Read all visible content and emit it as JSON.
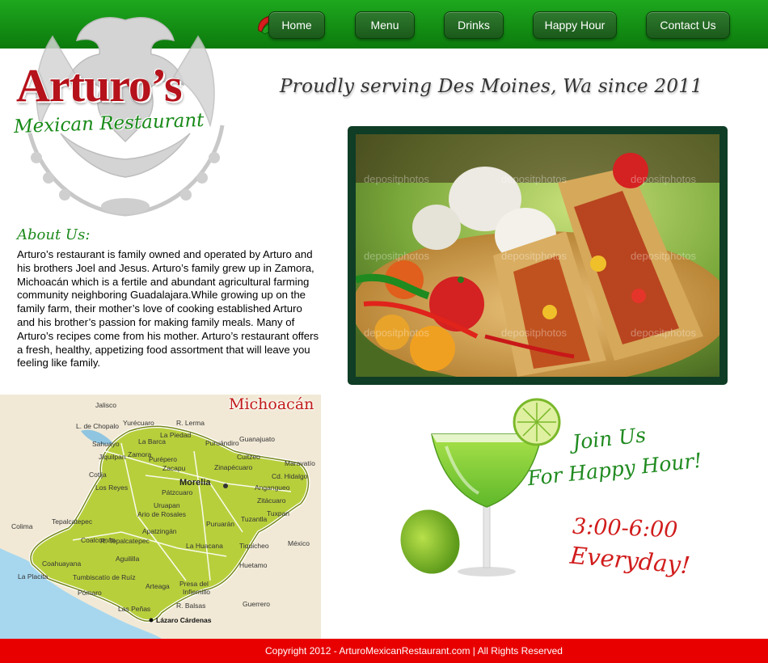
{
  "nav": {
    "items": [
      {
        "label": "Home"
      },
      {
        "label": "Menu"
      },
      {
        "label": "Drinks"
      },
      {
        "label": "Happy Hour"
      },
      {
        "label": "Contact Us"
      }
    ]
  },
  "logo": {
    "title": "Arturo’s",
    "subtitle": "Mexican Restaurant"
  },
  "tagline": "Proudly serving Des Moines, Wa since 2011",
  "about": {
    "heading": "About Us:",
    "text": "Arturo’s restaurant is family owned and operated by Arturo and his brothers Joel and Jesus. Arturo’s family grew up in Zamora, Michoacán which is a fertile and abundant agricultural farming community neighboring Guadalajara.While growing up on the family farm, their mother’s love of cooking established Arturo and his brother’s passion for making family meals. Many of Arturo’s recipes come from his mother. Arturo’s restaurant offers a fresh, healthy, appetizing food assortment that will leave you feeling like family."
  },
  "map": {
    "title": "Michoacán",
    "labels": [
      "Jalisco",
      "L. de Chopalo",
      "Yurécuaro",
      "R. Lerma",
      "Guanajuato",
      "La Piedad",
      "Sahuayo",
      "La Barca",
      "Jiquilpan",
      "Zamora",
      "Cotija",
      "Los Reyes",
      "Purépero",
      "Puruándiro",
      "Zacapu",
      "Pátzcuaro",
      "Morelia",
      "Zinapécuaro",
      "Cuitzeo",
      "Maravatío",
      "Cd. Hidalgo",
      "Angangueo",
      "Zitácuaro",
      "Tuxpan",
      "Uruapan",
      "Ario de Rosales",
      "Apatzingán",
      "Tepalcatepec",
      "Coalcomán",
      "Aguililla",
      "La Huacana",
      "Puruarán",
      "Tiquicheo",
      "Huetamo",
      "Colima",
      "Coahuayana",
      "La Placita",
      "Tumbiscatío de Ruíz",
      "Pómaro",
      "Arteaga",
      "Infiernillo",
      "Presa del",
      "Las Peñas",
      "R. Balsas",
      "Lázaro Cárdenas",
      "Guerrero",
      "México",
      "Tuzantla",
      "R. Tepalcatepec"
    ]
  },
  "happy_hour": {
    "line1": "Join Us",
    "line2": "For Happy Hour!",
    "time": "3:00-6:00",
    "days": "Everyday!"
  },
  "footer": {
    "copyright": "Copyright 2012 - ArturoMexicanRestaurant.com | All Rights Reserved"
  },
  "colors": {
    "header_green": "#1ea81e",
    "nav_button": "#2f7a2f",
    "logo_red": "#b5121b",
    "logo_green": "#188a18",
    "footer_red": "#e80000",
    "photo_frame": "#0f3d26"
  }
}
